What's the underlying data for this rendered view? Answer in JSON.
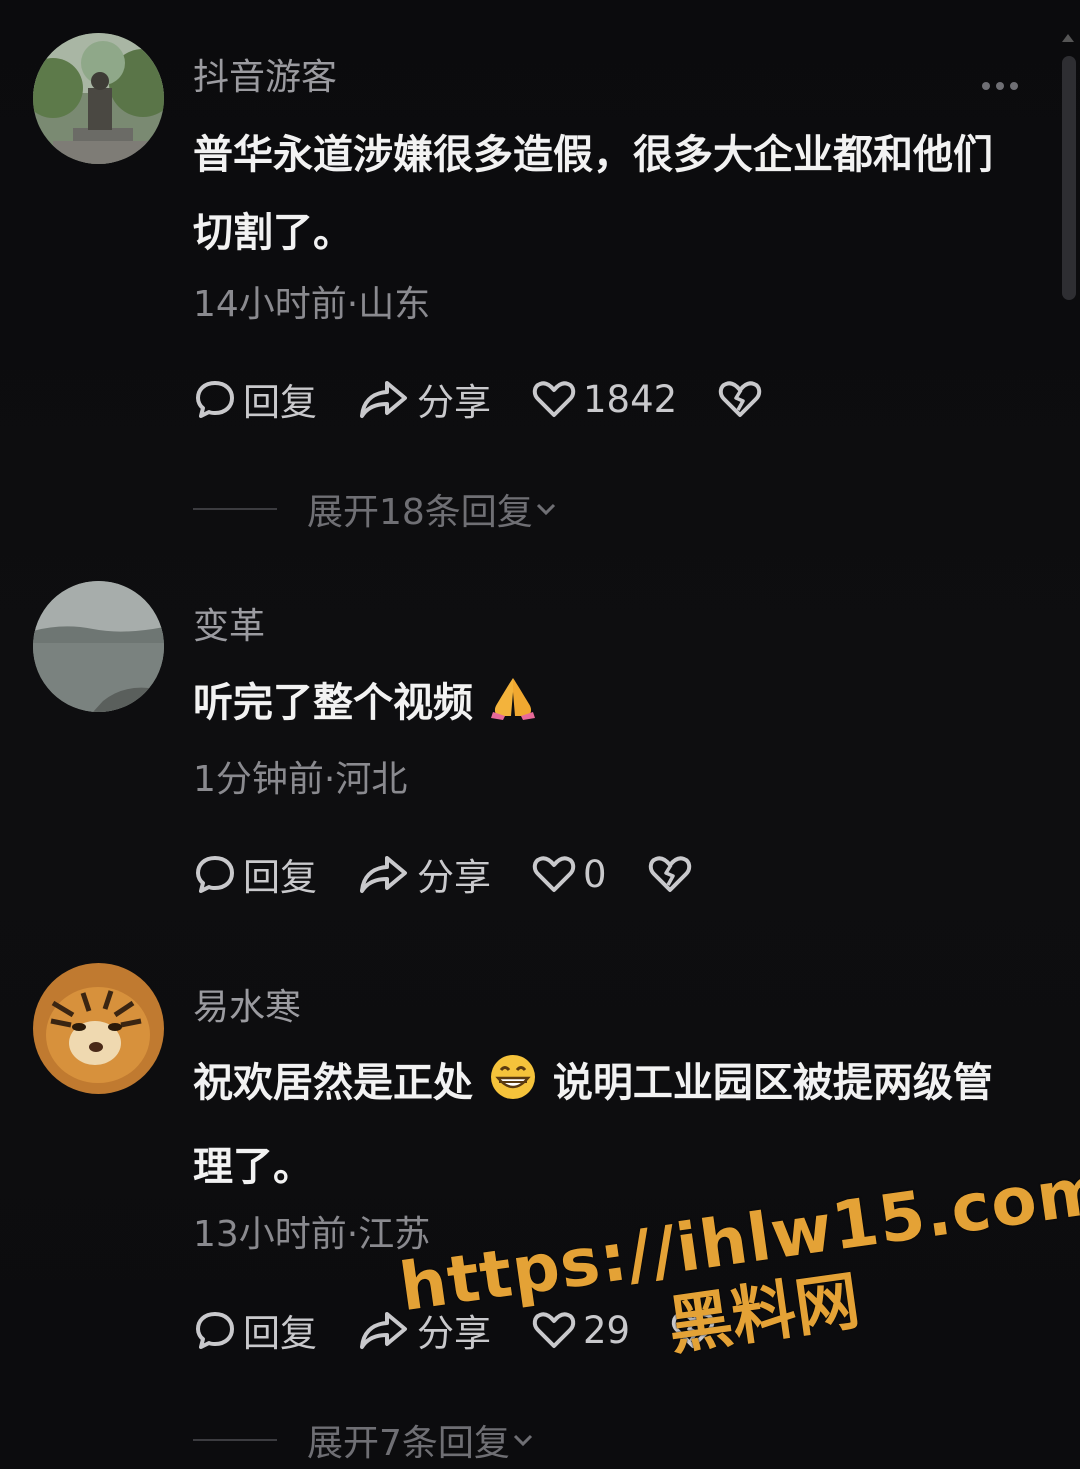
{
  "comments": [
    {
      "username": "抖音游客",
      "text": "普华永道涉嫌很多造假，很多大企业都和他们切割了。",
      "meta": "14小时前·山东",
      "reply_label": "回复",
      "share_label": "分享",
      "likes": "1842",
      "expand": "展开18条回复"
    },
    {
      "username": "变革",
      "text": "听完了整个视频",
      "emoji": "🙏",
      "meta": "1分钟前·河北",
      "reply_label": "回复",
      "share_label": "分享",
      "likes": "0"
    },
    {
      "username": "易水寒",
      "text_before_emoji": "祝欢居然是正处",
      "emoji": "😁",
      "text_after_emoji": "说明工业园区被提两级管理了。",
      "meta": "13小时前·江苏",
      "reply_label": "回复",
      "share_label": "分享",
      "likes": "29",
      "expand": "展开7条回复"
    }
  ],
  "watermark": {
    "url": "https://ihlw15.com",
    "site": "黑料网"
  },
  "colors": {
    "background": "#0d0d0f",
    "username": "#9b9ba0",
    "text": "#f2f2f2",
    "watermark": "#e4a236"
  },
  "icons": [
    "more-icon",
    "reply-icon",
    "share-icon",
    "like-icon",
    "dislike-icon",
    "chevron-down-icon"
  ]
}
